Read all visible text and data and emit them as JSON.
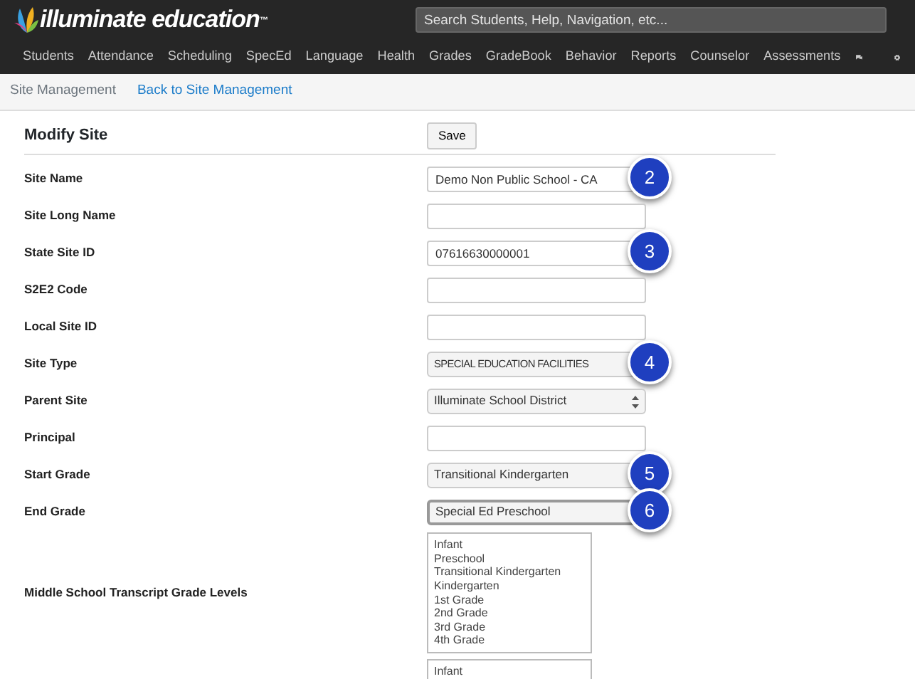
{
  "header": {
    "logo_text": "illuminate education",
    "logo_mark": "™",
    "search": {
      "placeholder": "Search Students, Help, Navigation, etc..."
    }
  },
  "nav": [
    "Students",
    "Attendance",
    "Scheduling",
    "SpecEd",
    "Language",
    "Health",
    "Grades",
    "GradeBook",
    "Behavior",
    "Reports",
    "Counselor",
    "Assessments"
  ],
  "breadcrumb": {
    "title": "Site Management",
    "link": "Back to Site Management"
  },
  "form": {
    "title": "Modify Site",
    "save_button": "Save",
    "rows": [
      {
        "label": "Site Name",
        "kind": "text",
        "value": "Demo Non Public School - CA",
        "callout": "2"
      },
      {
        "label": "Site Long Name",
        "kind": "text"
      },
      {
        "label": "State Site ID",
        "kind": "text",
        "value": "07616630000001",
        "callout": "3"
      },
      {
        "label": "S2E2 Code",
        "kind": "text"
      },
      {
        "label": "Local Site ID",
        "kind": "text"
      },
      {
        "label": "Site Type",
        "kind": "select",
        "value": "SPECIAL EDUCATION FACILITIES",
        "callout": "4"
      },
      {
        "label": "Parent Site",
        "kind": "select",
        "value": "Illuminate School District",
        "arrows": true
      },
      {
        "label": "Principal",
        "kind": "text"
      },
      {
        "label": "Start Grade",
        "kind": "select",
        "value": "Transitional Kindergarten",
        "callout": "5"
      },
      {
        "label": "End Grade",
        "kind": "select",
        "value": "Special Ed Preschool",
        "callout": "6",
        "focused": true
      },
      {
        "label": "Middle School Transcript Grade Levels",
        "kind": "listbox",
        "options": [
          "Infant",
          "Preschool",
          "Transitional Kindergarten",
          "Kindergarten",
          "1st Grade",
          "2nd Grade",
          "3rd Grade",
          "4th Grade"
        ]
      },
      {
        "kind": "listbox",
        "options": [
          "Infant"
        ]
      }
    ]
  }
}
